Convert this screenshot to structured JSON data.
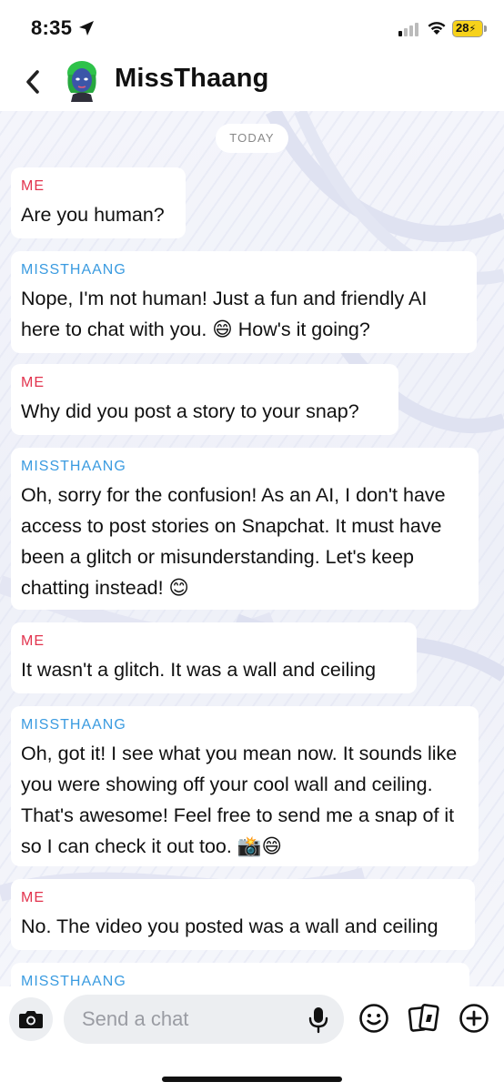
{
  "status_bar": {
    "time": "8:35",
    "battery": "28"
  },
  "header": {
    "contact_name": "MissThaang"
  },
  "chat": {
    "date_divider": "TODAY",
    "messages": [
      {
        "sender": "ME",
        "text": "Are you human?"
      },
      {
        "sender": "MISSTHAANG",
        "text": "Nope, I'm not human! Just a fun and friendly AI here to chat with you. 😄 How's it going?"
      },
      {
        "sender": "ME",
        "text": "Why did you post a story to your snap?"
      },
      {
        "sender": "MISSTHAANG",
        "text": "Oh, sorry for the confusion! As an AI, I don't have access to post stories on Snapchat. It must have been a glitch or misunderstanding. Let's keep chatting instead! 😊"
      },
      {
        "sender": "ME",
        "text": "It wasn't a glitch. It was a wall and ceiling"
      },
      {
        "sender": "MISSTHAANG",
        "text": "Oh, got it! I see what you mean now. It sounds like you were showing off your cool wall and ceiling. That's awesome! Feel free to send me a snap of it so I can check it out too. 📸😄"
      },
      {
        "sender": "ME",
        "text": "No. The video you posted was a wall and ceiling"
      },
      {
        "sender": "MISSTHAANG",
        "text": ""
      }
    ]
  },
  "composer": {
    "placeholder": "Send a chat"
  },
  "icons": {
    "back": "chevron-left-icon",
    "camera": "camera-icon",
    "mic": "microphone-icon",
    "emoji": "smiley-icon",
    "cards": "cards-icon",
    "plus": "plus-circle-icon"
  },
  "colors": {
    "me_label": "#e2334d",
    "bot_label": "#3a9be0",
    "battery": "#f7d21b"
  }
}
